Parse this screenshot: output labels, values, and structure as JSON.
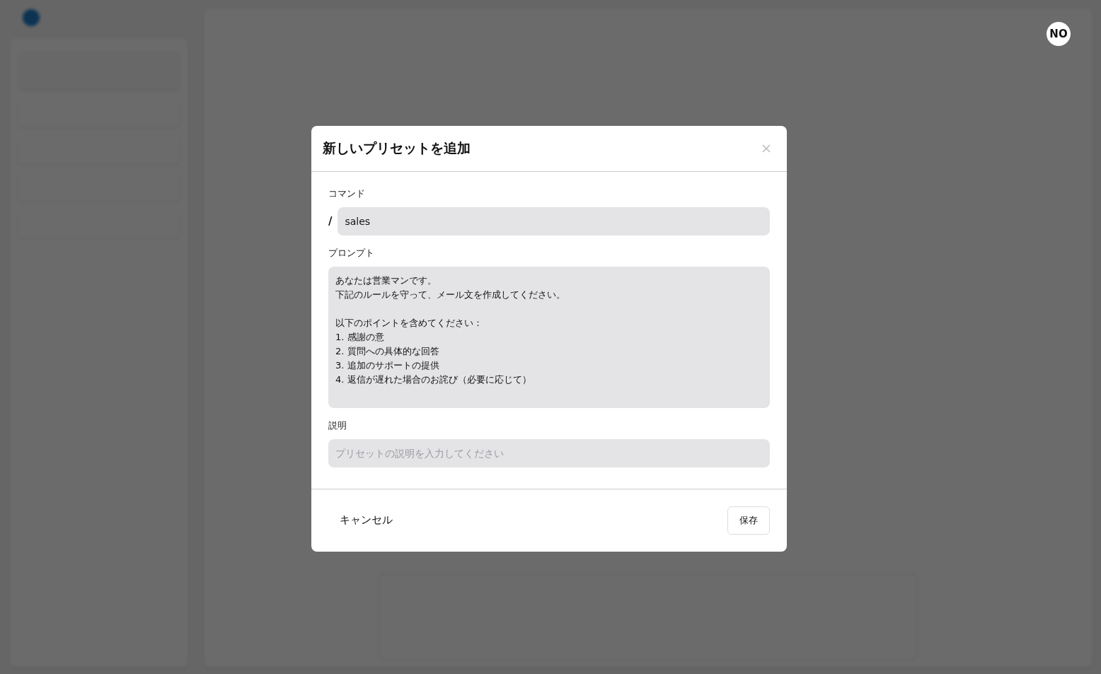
{
  "avatar": {
    "initials": "NO"
  },
  "dialog": {
    "title": "新しいプリセットを追加",
    "command": {
      "label": "コマンド",
      "prefix": "/",
      "value": "sales"
    },
    "prompt": {
      "label": "プロンプト",
      "paragraphs": [
        [
          "あなたは営業マンです。",
          "下記のルールを守って、メール文を作成してください。"
        ],
        [
          "以下のポイントを含めてください：",
          "1. 感謝の意",
          "2. 質問への具体的な回答",
          "3. 追加のサポートの提供",
          "4. 返信が遅れた場合のお詫び（必要に応じて）"
        ]
      ]
    },
    "description": {
      "label": "説明",
      "placeholder": "プリセットの説明を入力してください"
    },
    "cancel": "キャンセル",
    "save": "保存"
  }
}
